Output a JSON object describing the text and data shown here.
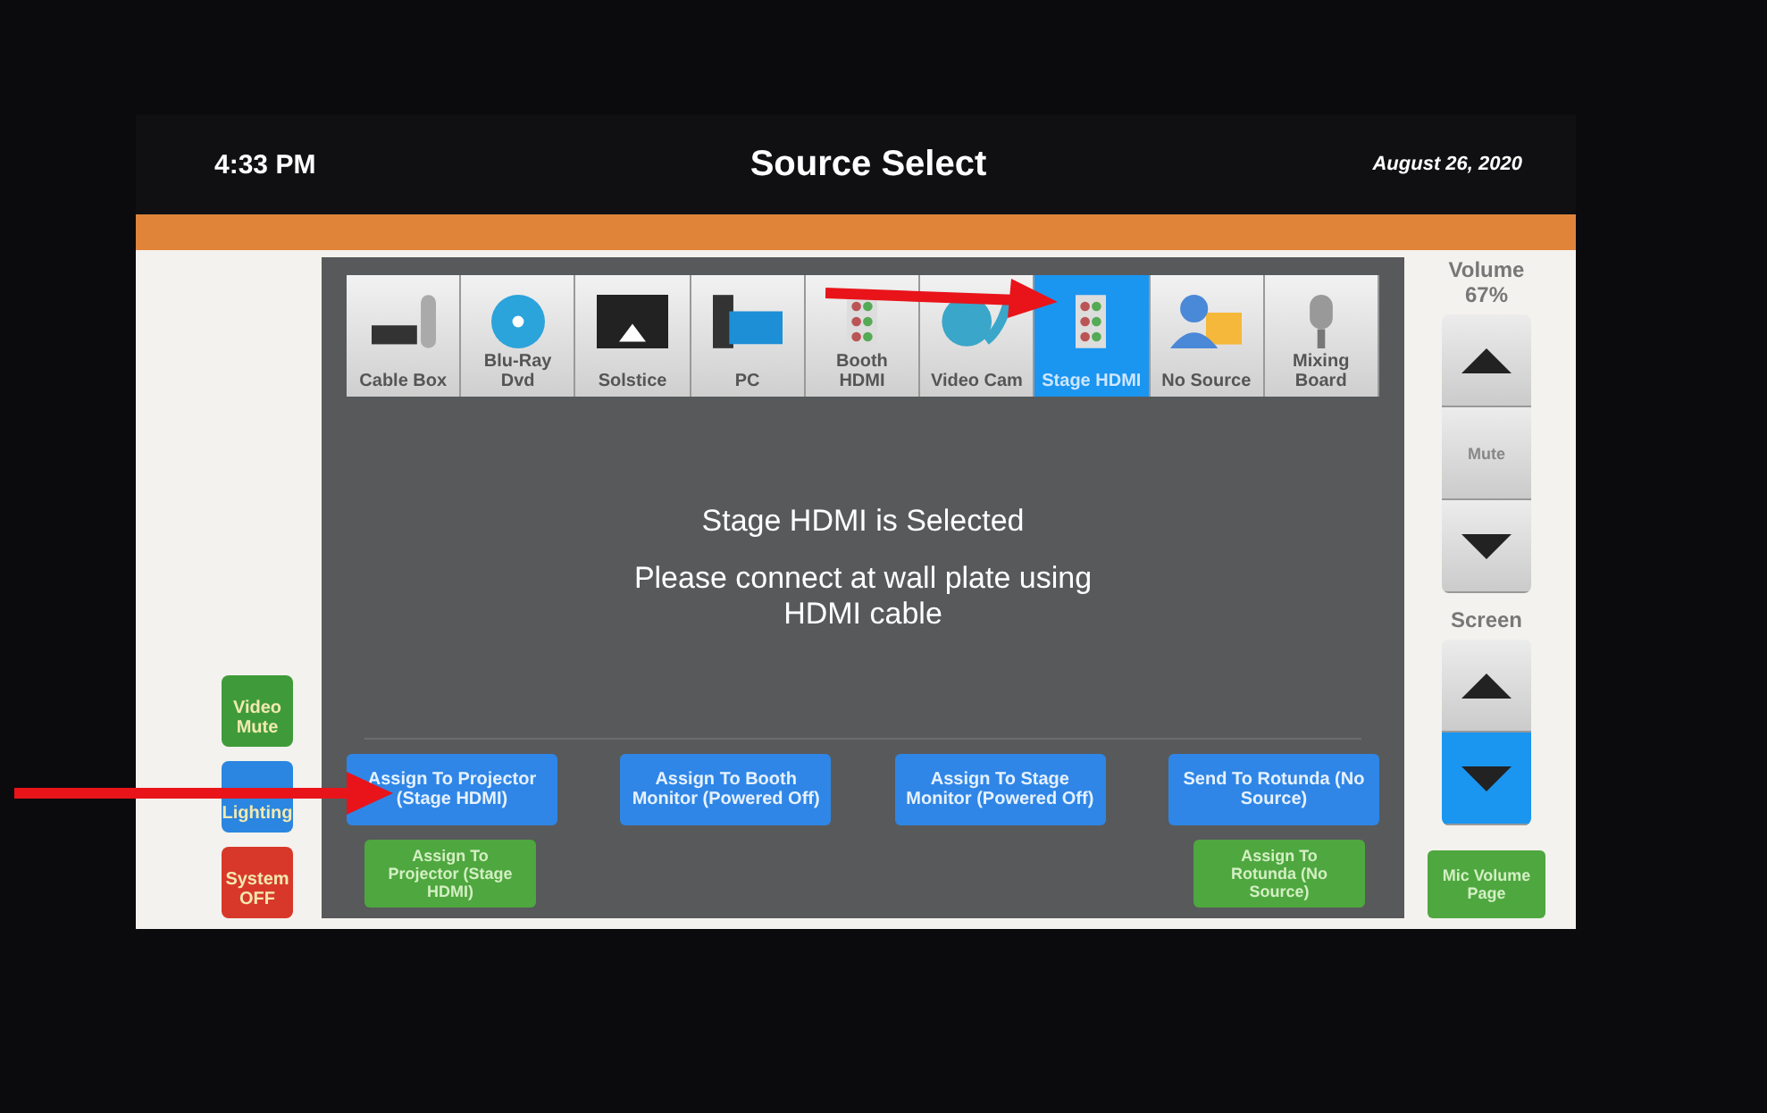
{
  "header": {
    "time": "4:33 PM",
    "title": "Source Select",
    "date": "August 26, 2020"
  },
  "left_buttons": [
    {
      "label": "Video Mute",
      "color": "#3f9b3a"
    },
    {
      "label": "Lighting",
      "color": "#2a86e0"
    },
    {
      "label": "System OFF",
      "color": "#d8382a"
    }
  ],
  "sources": [
    {
      "label": "Cable Box",
      "kind": "cable",
      "selected": false
    },
    {
      "label": "Blu-Ray Dvd",
      "kind": "disc",
      "selected": false
    },
    {
      "label": "Solstice",
      "kind": "cast",
      "selected": false
    },
    {
      "label": "PC",
      "kind": "computer",
      "selected": false
    },
    {
      "label": "Booth HDMI",
      "kind": "hdmi",
      "selected": false
    },
    {
      "label": "Video Cam",
      "kind": "camera",
      "selected": false
    },
    {
      "label": "Stage HDMI",
      "kind": "hdmi",
      "selected": true
    },
    {
      "label": "No Source",
      "kind": "person",
      "selected": false
    },
    {
      "label": "Mixing Board",
      "kind": "microphone",
      "selected": false
    }
  ],
  "message": {
    "heading": "Stage HDMI is Selected",
    "body": "Please connect at wall plate using HDMI cable"
  },
  "route_buttons": [
    {
      "label": "Assign To Projector (Stage HDMI)",
      "kind": "primary"
    },
    {
      "label": "Assign To Booth Monitor (Powered Off)",
      "kind": "primary"
    },
    {
      "label": "Assign To Stage Monitor (Powered Off)",
      "kind": "primary"
    },
    {
      "label": "Send To Rotunda (No Source)",
      "kind": "primary"
    }
  ],
  "secondary_buttons": [
    {
      "label": "Assign To Projector (Stage HDMI)",
      "kind": "secondary"
    },
    {
      "label": "Assign To Rotunda (No Source)",
      "kind": "secondary"
    }
  ],
  "volume": {
    "label": "Volume",
    "reading": "67%",
    "mute": "Mute"
  },
  "screen": {
    "label": "Screen",
    "up_selected": false,
    "down_selected": true
  },
  "mic_button": {
    "label": "Mic Volume Page"
  }
}
